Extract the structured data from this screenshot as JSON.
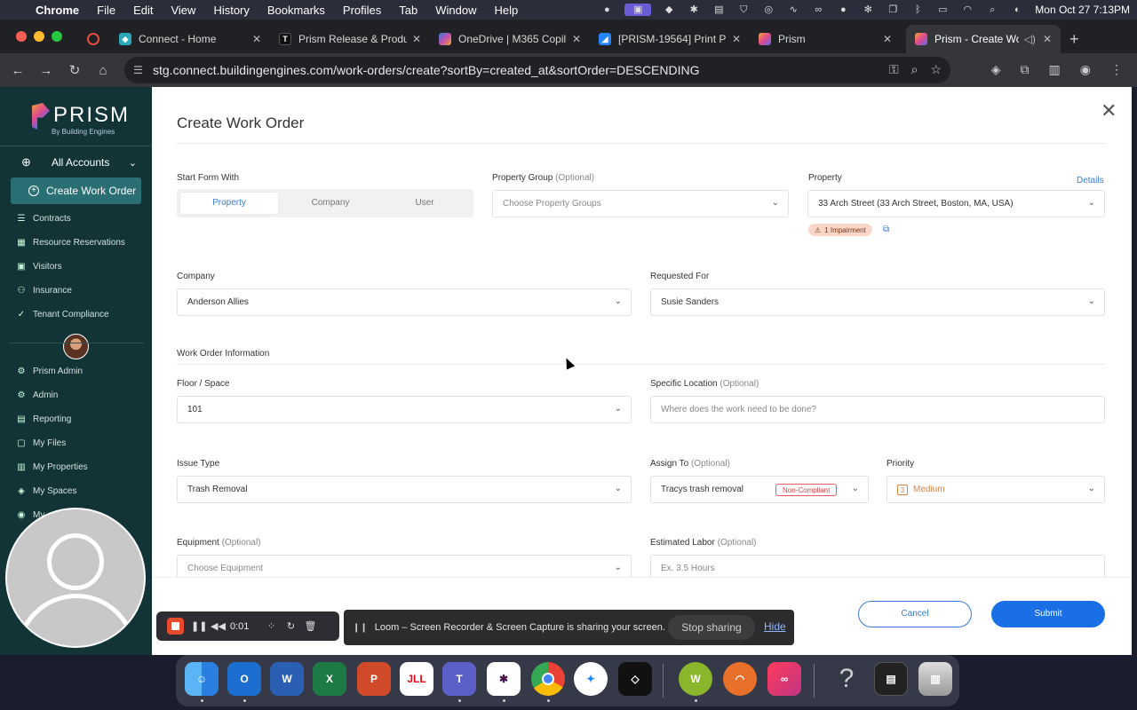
{
  "menubar": {
    "app": "Chrome",
    "items": [
      "File",
      "Edit",
      "View",
      "History",
      "Bookmarks",
      "Profiles",
      "Tab",
      "Window",
      "Help"
    ],
    "clock": "Mon Oct 27  7:13PM"
  },
  "tabs": [
    {
      "title": "Connect - Home",
      "icon": "connect-icon"
    },
    {
      "title": "Prism Release & Produ",
      "icon": "t-icon"
    },
    {
      "title": "OneDrive | M365 Copil",
      "icon": "onedrive-icon"
    },
    {
      "title": "[PRISM-19564] Print P",
      "icon": "jira-icon"
    },
    {
      "title": "Prism",
      "icon": "prism-icon"
    },
    {
      "title": "Prism - Create Wor",
      "icon": "prism-icon"
    }
  ],
  "address": {
    "url": "stg.connect.buildingengines.com/work-orders/create?sortBy=created_at&sortOrder=DESCENDING"
  },
  "sidebar": {
    "logo_word": "PRISM",
    "logo_sub": "By Building Engines",
    "accounts_label": "All Accounts",
    "create_label": "Create Work Order",
    "items_top": [
      {
        "label": "Contracts",
        "icon": "contract-icon"
      },
      {
        "label": "Resource Reservations",
        "icon": "calendar-icon"
      },
      {
        "label": "Visitors",
        "icon": "visitor-icon"
      },
      {
        "label": "Insurance",
        "icon": "insurance-icon"
      },
      {
        "label": "Tenant Compliance",
        "icon": "compliance-icon"
      }
    ],
    "items_bottom": [
      {
        "label": "Prism Admin",
        "icon": "gear-icon"
      },
      {
        "label": "Admin",
        "icon": "gear-icon"
      },
      {
        "label": "Reporting",
        "icon": "report-icon"
      },
      {
        "label": "My Files",
        "icon": "file-icon"
      },
      {
        "label": "My Properties",
        "icon": "building-icon"
      },
      {
        "label": "My Spaces",
        "icon": "layers-icon"
      },
      {
        "label": "My",
        "icon": "user-icon"
      }
    ]
  },
  "form": {
    "title": "Create Work Order",
    "start_form_label": "Start Form With",
    "start_options": [
      "Property",
      "Company",
      "User"
    ],
    "start_selected": "Property",
    "property_group_label": "Property Group",
    "optional": "(Optional)",
    "property_group_placeholder": "Choose Property Groups",
    "property_label": "Property",
    "details_link": "Details",
    "property_value": "33 Arch Street (33 Arch Street, Boston, MA, USA)",
    "impairment_badge": "1 Impairment",
    "company_label": "Company",
    "company_value": "Anderson Allies",
    "requested_for_label": "Requested For",
    "requested_for_value": "Susie Sanders",
    "section_title": "Work Order Information",
    "floor_label": "Floor / Space",
    "floor_value": "101",
    "specific_location_label": "Specific Location",
    "specific_location_placeholder": "Where does the work need to be done?",
    "issue_type_label": "Issue Type",
    "issue_type_value": "Trash Removal",
    "assign_to_label": "Assign To",
    "assign_to_value": "Tracys trash removal",
    "non_compliant_badge": "Non-Compliant",
    "priority_label": "Priority",
    "priority_num": "3",
    "priority_value": "Medium",
    "equipment_label": "Equipment",
    "equipment_placeholder": "Choose Equipment",
    "labor_label": "Estimated Labor",
    "labor_placeholder": "Ex. 3.5 Hours",
    "cancel_label": "Cancel",
    "submit_label": "Submit"
  },
  "loom": {
    "timer": "0:01",
    "share_message": "Loom – Screen Recorder & Screen Capture is sharing your screen.",
    "stop_sharing": "Stop sharing",
    "hide": "Hide"
  },
  "dock": {
    "apps": [
      "finder-icon",
      "outlook-icon",
      "word-icon",
      "excel-icon",
      "powerpoint-icon",
      "jll-icon",
      "teams-icon",
      "slack-icon",
      "chrome-icon",
      "safari-icon",
      "unity-icon",
      "w-icon",
      "headset-icon",
      "creative-cloud-icon",
      "help-icon",
      "notes-icon",
      "trash-icon"
    ],
    "jll_text": "JLL",
    "w_text": "W"
  },
  "colors": {
    "sidebar_bg": "#123437",
    "accent_blue": "#1a6ee6",
    "create_btn": "#2a6f73",
    "priority_orange": "#d8834a"
  }
}
